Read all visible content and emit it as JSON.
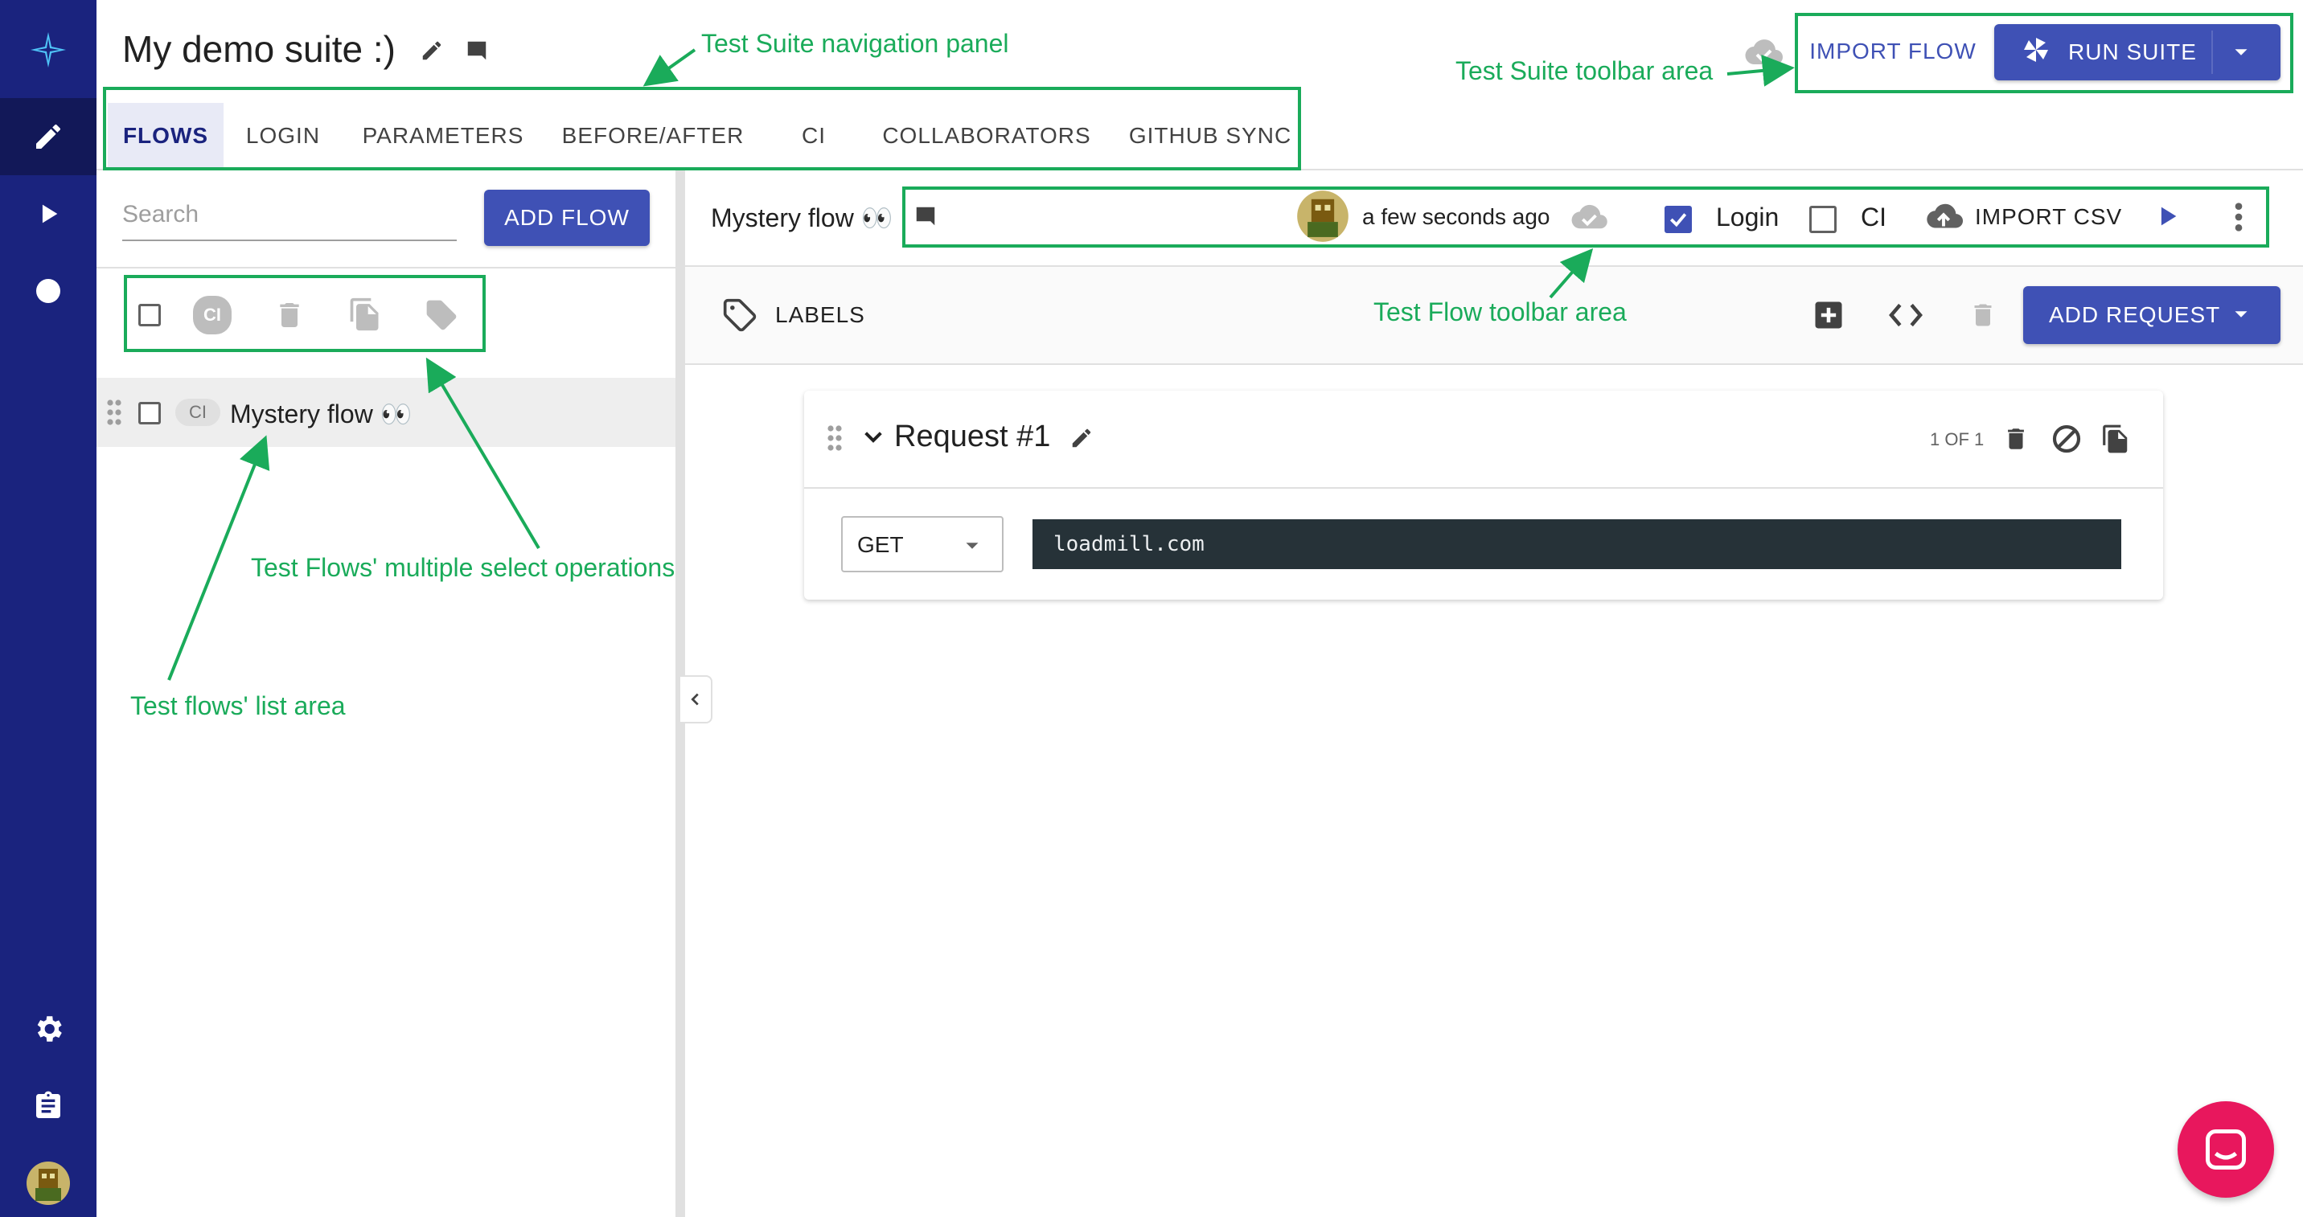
{
  "suite": {
    "title": "My demo suite :)"
  },
  "tabs": [
    {
      "label": "FLOWS"
    },
    {
      "label": "LOGIN"
    },
    {
      "label": "PARAMETERS"
    },
    {
      "label": "BEFORE/AFTER"
    },
    {
      "label": "CI"
    },
    {
      "label": "COLLABORATORS"
    },
    {
      "label": "GITHUB SYNC"
    }
  ],
  "toolbar": {
    "import_flow": "IMPORT FLOW",
    "run_suite": "RUN SUITE"
  },
  "flows_panel": {
    "search_placeholder": "Search",
    "add_flow": "ADD FLOW",
    "ci_chip": "CI",
    "flows": [
      {
        "name": "Mystery flow 👀",
        "ci": "CI"
      }
    ]
  },
  "flow_toolbar": {
    "name": "Mystery flow 👀",
    "updated": "a few seconds ago",
    "login_label": "Login",
    "ci_label": "CI",
    "import_csv": "IMPORT CSV"
  },
  "labels_bar": {
    "labels": "LABELS",
    "add_request": "ADD REQUEST"
  },
  "request": {
    "title": "Request #1",
    "counter": "1 OF 1",
    "method": "GET",
    "url": "loadmill.com"
  },
  "annotations": {
    "nav_panel": "Test Suite navigation panel",
    "suite_toolbar": "Test Suite toolbar area",
    "flow_toolbar": "Test Flow toolbar area",
    "multi_select": "Test Flows' multiple select operations",
    "list_area": "Test flows' list area"
  },
  "colors": {
    "rail": "#1a237e",
    "primary": "#3f51b5",
    "annotation": "#1aab5a",
    "chat": "#e8175d"
  }
}
